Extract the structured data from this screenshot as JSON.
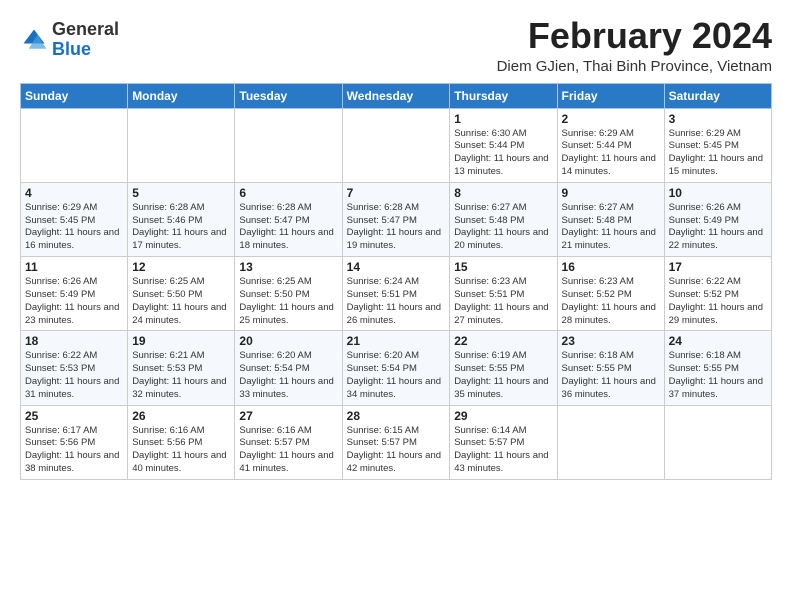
{
  "logo": {
    "general": "General",
    "blue": "Blue"
  },
  "title": "February 2024",
  "subtitle": "Diem GJien, Thai Binh Province, Vietnam",
  "days_header": [
    "Sunday",
    "Monday",
    "Tuesday",
    "Wednesday",
    "Thursday",
    "Friday",
    "Saturday"
  ],
  "weeks": [
    [
      {
        "day": "",
        "info": ""
      },
      {
        "day": "",
        "info": ""
      },
      {
        "day": "",
        "info": ""
      },
      {
        "day": "",
        "info": ""
      },
      {
        "day": "1",
        "info": "Sunrise: 6:30 AM\nSunset: 5:44 PM\nDaylight: 11 hours and 13 minutes."
      },
      {
        "day": "2",
        "info": "Sunrise: 6:29 AM\nSunset: 5:44 PM\nDaylight: 11 hours and 14 minutes."
      },
      {
        "day": "3",
        "info": "Sunrise: 6:29 AM\nSunset: 5:45 PM\nDaylight: 11 hours and 15 minutes."
      }
    ],
    [
      {
        "day": "4",
        "info": "Sunrise: 6:29 AM\nSunset: 5:45 PM\nDaylight: 11 hours and 16 minutes."
      },
      {
        "day": "5",
        "info": "Sunrise: 6:28 AM\nSunset: 5:46 PM\nDaylight: 11 hours and 17 minutes."
      },
      {
        "day": "6",
        "info": "Sunrise: 6:28 AM\nSunset: 5:47 PM\nDaylight: 11 hours and 18 minutes."
      },
      {
        "day": "7",
        "info": "Sunrise: 6:28 AM\nSunset: 5:47 PM\nDaylight: 11 hours and 19 minutes."
      },
      {
        "day": "8",
        "info": "Sunrise: 6:27 AM\nSunset: 5:48 PM\nDaylight: 11 hours and 20 minutes."
      },
      {
        "day": "9",
        "info": "Sunrise: 6:27 AM\nSunset: 5:48 PM\nDaylight: 11 hours and 21 minutes."
      },
      {
        "day": "10",
        "info": "Sunrise: 6:26 AM\nSunset: 5:49 PM\nDaylight: 11 hours and 22 minutes."
      }
    ],
    [
      {
        "day": "11",
        "info": "Sunrise: 6:26 AM\nSunset: 5:49 PM\nDaylight: 11 hours and 23 minutes."
      },
      {
        "day": "12",
        "info": "Sunrise: 6:25 AM\nSunset: 5:50 PM\nDaylight: 11 hours and 24 minutes."
      },
      {
        "day": "13",
        "info": "Sunrise: 6:25 AM\nSunset: 5:50 PM\nDaylight: 11 hours and 25 minutes."
      },
      {
        "day": "14",
        "info": "Sunrise: 6:24 AM\nSunset: 5:51 PM\nDaylight: 11 hours and 26 minutes."
      },
      {
        "day": "15",
        "info": "Sunrise: 6:23 AM\nSunset: 5:51 PM\nDaylight: 11 hours and 27 minutes."
      },
      {
        "day": "16",
        "info": "Sunrise: 6:23 AM\nSunset: 5:52 PM\nDaylight: 11 hours and 28 minutes."
      },
      {
        "day": "17",
        "info": "Sunrise: 6:22 AM\nSunset: 5:52 PM\nDaylight: 11 hours and 29 minutes."
      }
    ],
    [
      {
        "day": "18",
        "info": "Sunrise: 6:22 AM\nSunset: 5:53 PM\nDaylight: 11 hours and 31 minutes."
      },
      {
        "day": "19",
        "info": "Sunrise: 6:21 AM\nSunset: 5:53 PM\nDaylight: 11 hours and 32 minutes."
      },
      {
        "day": "20",
        "info": "Sunrise: 6:20 AM\nSunset: 5:54 PM\nDaylight: 11 hours and 33 minutes."
      },
      {
        "day": "21",
        "info": "Sunrise: 6:20 AM\nSunset: 5:54 PM\nDaylight: 11 hours and 34 minutes."
      },
      {
        "day": "22",
        "info": "Sunrise: 6:19 AM\nSunset: 5:55 PM\nDaylight: 11 hours and 35 minutes."
      },
      {
        "day": "23",
        "info": "Sunrise: 6:18 AM\nSunset: 5:55 PM\nDaylight: 11 hours and 36 minutes."
      },
      {
        "day": "24",
        "info": "Sunrise: 6:18 AM\nSunset: 5:55 PM\nDaylight: 11 hours and 37 minutes."
      }
    ],
    [
      {
        "day": "25",
        "info": "Sunrise: 6:17 AM\nSunset: 5:56 PM\nDaylight: 11 hours and 38 minutes."
      },
      {
        "day": "26",
        "info": "Sunrise: 6:16 AM\nSunset: 5:56 PM\nDaylight: 11 hours and 40 minutes."
      },
      {
        "day": "27",
        "info": "Sunrise: 6:16 AM\nSunset: 5:57 PM\nDaylight: 11 hours and 41 minutes."
      },
      {
        "day": "28",
        "info": "Sunrise: 6:15 AM\nSunset: 5:57 PM\nDaylight: 11 hours and 42 minutes."
      },
      {
        "day": "29",
        "info": "Sunrise: 6:14 AM\nSunset: 5:57 PM\nDaylight: 11 hours and 43 minutes."
      },
      {
        "day": "",
        "info": ""
      },
      {
        "day": "",
        "info": ""
      }
    ]
  ]
}
